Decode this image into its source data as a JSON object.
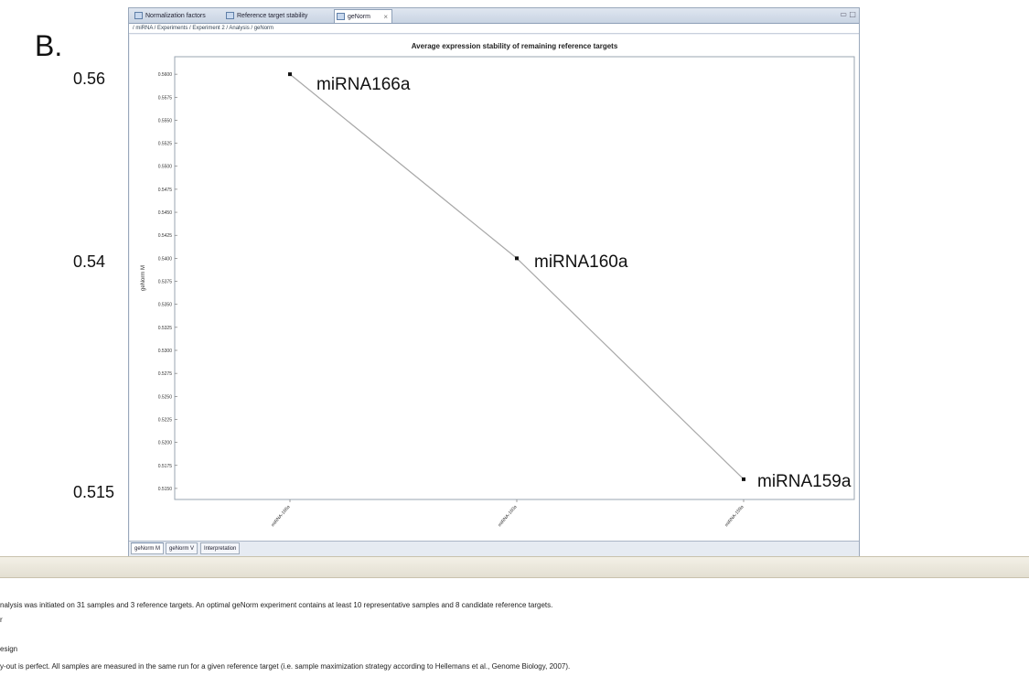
{
  "figure_label": "B.",
  "window": {
    "tabs": [
      {
        "label": "Normalization factors",
        "icon": "table-icon"
      },
      {
        "label": "Reference target stability",
        "icon": "chart-icon"
      },
      {
        "label": "geNorm",
        "icon": "chart-icon"
      }
    ],
    "active_tab": "geNorm",
    "breadcrumb": "/ miRNA / Experiments / Experiment 2 / Analysis / geNorm",
    "subtabs": [
      "geNorm M",
      "geNorm V",
      "Interpretation"
    ],
    "active_subtab": "geNorm M"
  },
  "chart_data": {
    "type": "line",
    "title": "Average expression stability of remaining reference targets",
    "ylabel": "geNorm M",
    "xlabel": "",
    "categories": [
      "miRNA-166a",
      "miRNA-160a",
      "miRNA-159a"
    ],
    "values": [
      0.56,
      0.54,
      0.516
    ],
    "ylim": [
      0.5138,
      0.5619
    ],
    "yticks": [
      "0.5600",
      "0.5575",
      "0.5550",
      "0.5525",
      "0.5500",
      "0.5475",
      "0.5450",
      "0.5425",
      "0.5400",
      "0.5375",
      "0.5350",
      "0.5325",
      "0.5300",
      "0.5275",
      "0.5250",
      "0.5225",
      "0.5200",
      "0.5175",
      "0.5150"
    ],
    "grid": false,
    "line_color": "#a8a8a8",
    "point_color": "#111111"
  },
  "annotations": {
    "y_labels": [
      {
        "text": "0.56",
        "value": 0.56
      },
      {
        "text": "0.54",
        "value": 0.54
      },
      {
        "text": "0.515",
        "value": 0.515
      }
    ],
    "point_labels": [
      "miRNA166a",
      "miRNA160a",
      "miRNA159a"
    ]
  },
  "bottom_panel": {
    "line1": "nalysis was initiated on 31 samples and 3 reference targets. An optimal geNorm experiment contains at least 10 representative samples and 8 candidate reference targets.",
    "line2": "r",
    "line3": "esign",
    "line4": "y-out is perfect. All samples are measured in the same run for a given reference target (i.e. sample maximization strategy according to Hellemans et al., Genome Biology, 2007)."
  }
}
